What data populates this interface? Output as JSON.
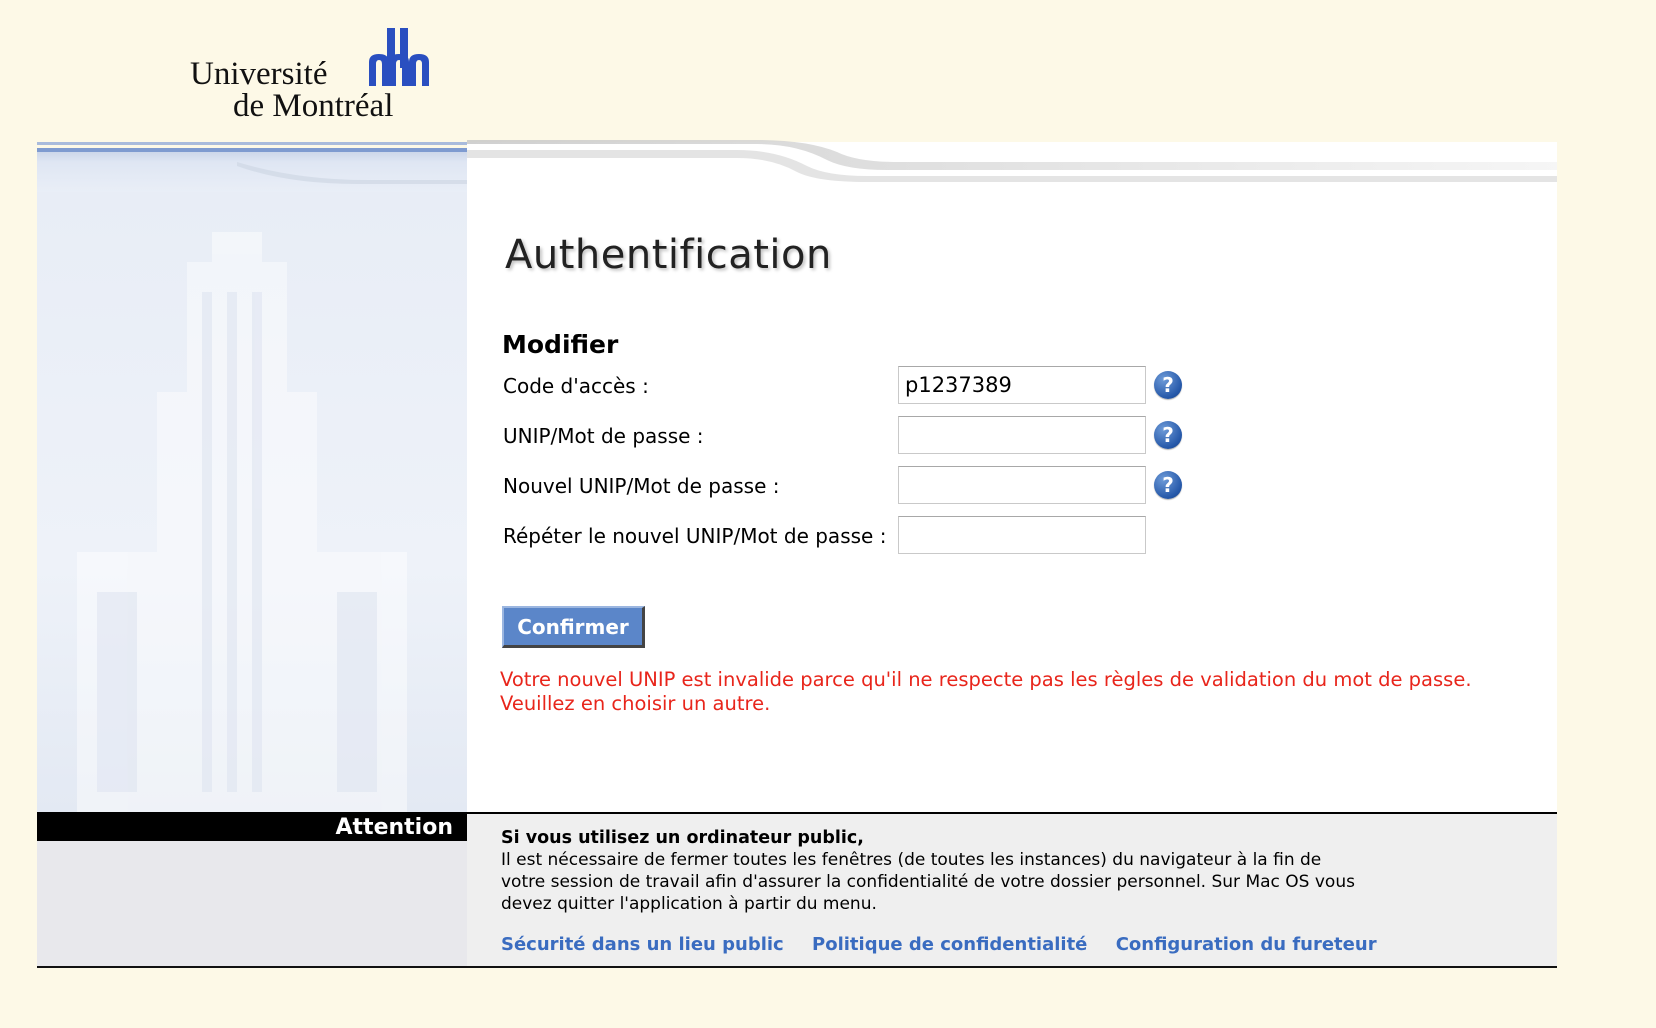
{
  "logo": {
    "line1": "Université",
    "line2": "de Montréal"
  },
  "page": {
    "title": "Authentification",
    "subtitle": "Modifier"
  },
  "form": {
    "fields": [
      {
        "label": "Code d'accès :",
        "value": "p1237389",
        "help": true
      },
      {
        "label": "UNIP/Mot de passe :",
        "value": "",
        "help": true
      },
      {
        "label": "Nouvel UNIP/Mot de passe :",
        "value": "",
        "help": true
      },
      {
        "label": "Répéter le nouvel UNIP/Mot de passe :",
        "value": "",
        "help": false
      }
    ],
    "help_glyph": "?",
    "confirm_label": "Confirmer"
  },
  "error": {
    "line1": "Votre nouvel UNIP est invalide parce qu'il ne respecte pas les règles de validation du mot de passe.",
    "line2": "Veuillez en choisir un autre."
  },
  "footer": {
    "attention_label": "Attention",
    "notice_title": "Si vous utilisez un ordinateur public,",
    "notice_line1": "Il est nécessaire de fermer toutes les fenêtres (de toutes les instances) du navigateur à la fin de",
    "notice_line2": "votre session de travail afin d'assurer la confidentialité de votre dossier personnel. Sur Mac OS vous",
    "notice_line3": "devez quitter l'application à partir du menu.",
    "links": [
      "Sécurité dans un lieu public",
      "Politique de confidentialité",
      "Configuration du fureteur"
    ]
  },
  "colors": {
    "page_bg": "#fdf9e7",
    "brand_blue": "#2a4fc0",
    "button_bg": "#5b86c9",
    "error_red": "#e8251b",
    "link_blue": "#3a6cc0"
  }
}
